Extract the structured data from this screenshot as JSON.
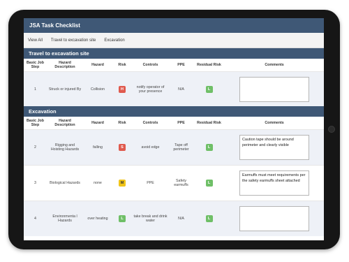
{
  "app": {
    "title": "JSA Task Checklist"
  },
  "tabs": [
    "View All",
    "Travel to excavation site",
    "Excavation"
  ],
  "columns": [
    "Basic Job Step",
    "Hazard Description",
    "Hazard",
    "Risk",
    "Controls",
    "PPE",
    "Residual Risk",
    "Comments"
  ],
  "sections": [
    {
      "title": "Travel to excavation site",
      "rows": [
        {
          "step": "1",
          "description": "Struck or injured By",
          "hazard": "Collision",
          "risk": "H",
          "risk_color": "#e05a4e",
          "controls": "notify operator of your presence",
          "ppe": "N/A",
          "residual": "L",
          "residual_color": "#6fbf67",
          "comment": ""
        }
      ]
    },
    {
      "title": "Excavation",
      "rows": [
        {
          "step": "2",
          "description": "Rigging and Hoisting Hazards",
          "hazard": "falling",
          "risk": "S",
          "risk_color": "#e05a4e",
          "controls": "avoid edge",
          "ppe": "Tape off perimeter",
          "residual": "L",
          "residual_color": "#6fbf67",
          "comment": "Caution tape should be around perimeter and clearly visible"
        },
        {
          "step": "3",
          "description": "Biological Hazards",
          "hazard": "none",
          "risk": "M",
          "risk_color": "#f0c419",
          "controls": "PPE",
          "ppe": "Safety earmuffs",
          "residual": "L",
          "residual_color": "#6fbf67",
          "comment": "Earmuffs must meet requirements per the safety earmuffs sheet attached"
        },
        {
          "step": "4",
          "description": "Environmenta l Hazards",
          "hazard": "over heating",
          "risk": "L",
          "risk_color": "#6fbf67",
          "controls": "take break and drink water",
          "ppe": "N/A",
          "residual": "L",
          "residual_color": "#6fbf67",
          "comment": ""
        }
      ]
    }
  ]
}
